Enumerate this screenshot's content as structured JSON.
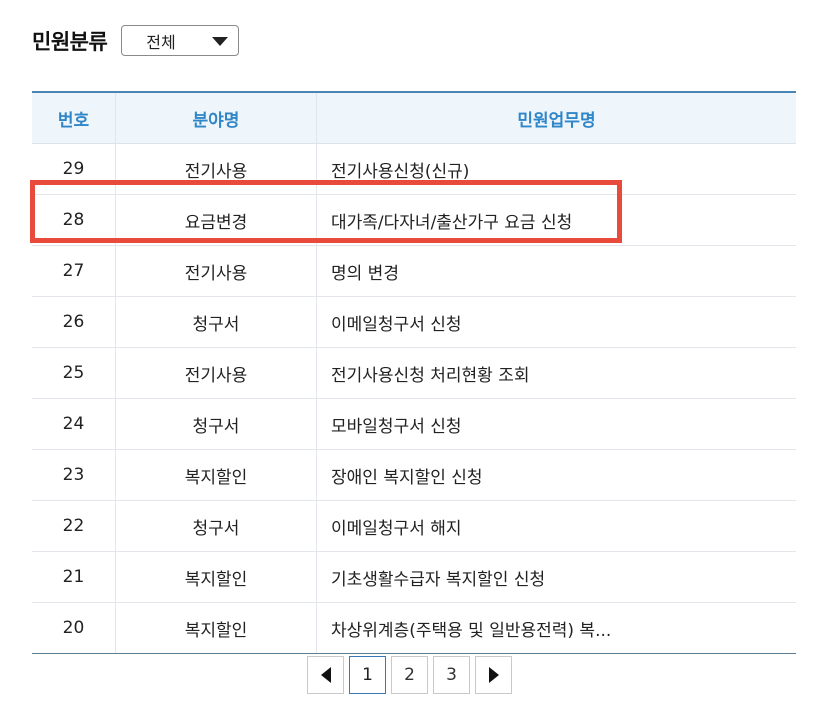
{
  "filter": {
    "label": "민원분류",
    "selected": "전체"
  },
  "table": {
    "headers": [
      "번호",
      "분야명",
      "민원업무명"
    ],
    "rows": [
      {
        "no": "29",
        "category": "전기사용",
        "name": "전기사용신청(신규)"
      },
      {
        "no": "28",
        "category": "요금변경",
        "name": "대가족/다자녀/출산가구 요금 신청"
      },
      {
        "no": "27",
        "category": "전기사용",
        "name": "명의 변경"
      },
      {
        "no": "26",
        "category": "청구서",
        "name": "이메일청구서 신청"
      },
      {
        "no": "25",
        "category": "전기사용",
        "name": "전기사용신청 처리현황 조회"
      },
      {
        "no": "24",
        "category": "청구서",
        "name": "모바일청구서 신청"
      },
      {
        "no": "23",
        "category": "복지할인",
        "name": "장애인 복지할인 신청"
      },
      {
        "no": "22",
        "category": "청구서",
        "name": "이메일청구서 해지"
      },
      {
        "no": "21",
        "category": "복지할인",
        "name": "기초생활수급자 복지할인 신청"
      },
      {
        "no": "20",
        "category": "복지할인",
        "name": "차상위계층(주택용 및 일반용전력) 복..."
      }
    ]
  },
  "highlighted_row": "28",
  "highlight_color": "#e84b3c",
  "header_text_color": "#2f86c8",
  "pagination": {
    "prev_icon": "triangle-left-icon",
    "next_icon": "triangle-right-icon",
    "pages": [
      "1",
      "2",
      "3"
    ],
    "current": "1"
  }
}
